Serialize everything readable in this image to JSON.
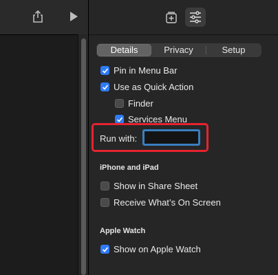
{
  "toolbar_left": {
    "share_icon": "share-icon",
    "run_icon": "play-icon"
  },
  "toolbar_right": {
    "library_icon": "add-to-library-icon",
    "settings_icon": "sliders-icon"
  },
  "tabs": [
    {
      "label": "Details",
      "selected": true
    },
    {
      "label": "Privacy",
      "selected": false
    },
    {
      "label": "Setup",
      "selected": false
    }
  ],
  "details": {
    "pin_menu_bar": {
      "label": "Pin in Menu Bar",
      "checked": true
    },
    "quick_action": {
      "label": "Use as Quick Action",
      "checked": true
    },
    "finder": {
      "label": "Finder",
      "checked": false
    },
    "services_menu": {
      "label": "Services Menu",
      "checked": true
    },
    "run_with": {
      "label": "Run with:",
      "value": ""
    },
    "iphone_ipad_title": "iPhone and iPad",
    "share_sheet": {
      "label": "Show in Share Sheet",
      "checked": false
    },
    "whats_on_screen": {
      "label": "Receive What’s On Screen",
      "checked": false
    },
    "apple_watch_title": "Apple Watch",
    "show_on_watch": {
      "label": "Show on Apple Watch",
      "checked": true
    }
  },
  "colors": {
    "accent": "#2f7bf5",
    "highlight": "#e8232f",
    "focus_ring": "#3a7fc1"
  }
}
